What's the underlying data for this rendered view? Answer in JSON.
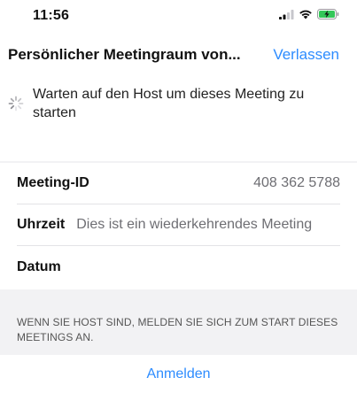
{
  "status_bar": {
    "time": "11:56",
    "icons": [
      "cellular-signal-icon",
      "wifi-icon",
      "battery-charging-icon"
    ]
  },
  "nav": {
    "title": "Persönlicher Meetingraum von...",
    "leave_label": "Verlassen"
  },
  "waiting": {
    "message": "Warten auf den Host um dieses Meeting zu starten"
  },
  "meeting_info": {
    "rows": [
      {
        "label": "Meeting-ID",
        "value": "408 362 5788"
      },
      {
        "label": "Uhrzeit",
        "value": "Dies ist ein wiederkehrendes Meeting"
      },
      {
        "label": "Datum",
        "value": ""
      }
    ]
  },
  "footer": {
    "note": "WENN SIE HOST SIND, MELDEN SIE SICH ZUM START DIESES MEETINGS AN.",
    "signin_label": "Anmelden"
  },
  "colors": {
    "accent": "#2d8cff",
    "battery": "#34c759",
    "secondary_text": "#6e6e73",
    "grouped_background": "#f2f2f4"
  }
}
